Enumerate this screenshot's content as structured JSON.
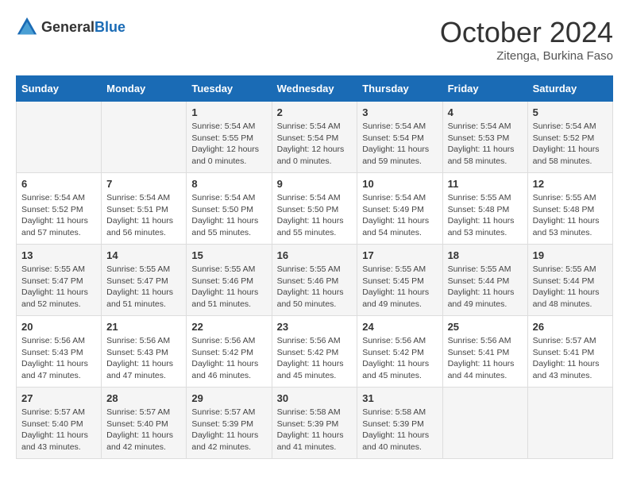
{
  "logo": {
    "text_general": "General",
    "text_blue": "Blue"
  },
  "title": "October 2024",
  "location": "Zitenga, Burkina Faso",
  "days_of_week": [
    "Sunday",
    "Monday",
    "Tuesday",
    "Wednesday",
    "Thursday",
    "Friday",
    "Saturday"
  ],
  "weeks": [
    [
      {
        "day": "",
        "info": ""
      },
      {
        "day": "",
        "info": ""
      },
      {
        "day": "1",
        "info": "Sunrise: 5:54 AM\nSunset: 5:55 PM\nDaylight: 12 hours\nand 0 minutes."
      },
      {
        "day": "2",
        "info": "Sunrise: 5:54 AM\nSunset: 5:54 PM\nDaylight: 12 hours\nand 0 minutes."
      },
      {
        "day": "3",
        "info": "Sunrise: 5:54 AM\nSunset: 5:54 PM\nDaylight: 11 hours\nand 59 minutes."
      },
      {
        "day": "4",
        "info": "Sunrise: 5:54 AM\nSunset: 5:53 PM\nDaylight: 11 hours\nand 58 minutes."
      },
      {
        "day": "5",
        "info": "Sunrise: 5:54 AM\nSunset: 5:52 PM\nDaylight: 11 hours\nand 58 minutes."
      }
    ],
    [
      {
        "day": "6",
        "info": "Sunrise: 5:54 AM\nSunset: 5:52 PM\nDaylight: 11 hours\nand 57 minutes."
      },
      {
        "day": "7",
        "info": "Sunrise: 5:54 AM\nSunset: 5:51 PM\nDaylight: 11 hours\nand 56 minutes."
      },
      {
        "day": "8",
        "info": "Sunrise: 5:54 AM\nSunset: 5:50 PM\nDaylight: 11 hours\nand 55 minutes."
      },
      {
        "day": "9",
        "info": "Sunrise: 5:54 AM\nSunset: 5:50 PM\nDaylight: 11 hours\nand 55 minutes."
      },
      {
        "day": "10",
        "info": "Sunrise: 5:54 AM\nSunset: 5:49 PM\nDaylight: 11 hours\nand 54 minutes."
      },
      {
        "day": "11",
        "info": "Sunrise: 5:55 AM\nSunset: 5:48 PM\nDaylight: 11 hours\nand 53 minutes."
      },
      {
        "day": "12",
        "info": "Sunrise: 5:55 AM\nSunset: 5:48 PM\nDaylight: 11 hours\nand 53 minutes."
      }
    ],
    [
      {
        "day": "13",
        "info": "Sunrise: 5:55 AM\nSunset: 5:47 PM\nDaylight: 11 hours\nand 52 minutes."
      },
      {
        "day": "14",
        "info": "Sunrise: 5:55 AM\nSunset: 5:47 PM\nDaylight: 11 hours\nand 51 minutes."
      },
      {
        "day": "15",
        "info": "Sunrise: 5:55 AM\nSunset: 5:46 PM\nDaylight: 11 hours\nand 51 minutes."
      },
      {
        "day": "16",
        "info": "Sunrise: 5:55 AM\nSunset: 5:46 PM\nDaylight: 11 hours\nand 50 minutes."
      },
      {
        "day": "17",
        "info": "Sunrise: 5:55 AM\nSunset: 5:45 PM\nDaylight: 11 hours\nand 49 minutes."
      },
      {
        "day": "18",
        "info": "Sunrise: 5:55 AM\nSunset: 5:44 PM\nDaylight: 11 hours\nand 49 minutes."
      },
      {
        "day": "19",
        "info": "Sunrise: 5:55 AM\nSunset: 5:44 PM\nDaylight: 11 hours\nand 48 minutes."
      }
    ],
    [
      {
        "day": "20",
        "info": "Sunrise: 5:56 AM\nSunset: 5:43 PM\nDaylight: 11 hours\nand 47 minutes."
      },
      {
        "day": "21",
        "info": "Sunrise: 5:56 AM\nSunset: 5:43 PM\nDaylight: 11 hours\nand 47 minutes."
      },
      {
        "day": "22",
        "info": "Sunrise: 5:56 AM\nSunset: 5:42 PM\nDaylight: 11 hours\nand 46 minutes."
      },
      {
        "day": "23",
        "info": "Sunrise: 5:56 AM\nSunset: 5:42 PM\nDaylight: 11 hours\nand 45 minutes."
      },
      {
        "day": "24",
        "info": "Sunrise: 5:56 AM\nSunset: 5:42 PM\nDaylight: 11 hours\nand 45 minutes."
      },
      {
        "day": "25",
        "info": "Sunrise: 5:56 AM\nSunset: 5:41 PM\nDaylight: 11 hours\nand 44 minutes."
      },
      {
        "day": "26",
        "info": "Sunrise: 5:57 AM\nSunset: 5:41 PM\nDaylight: 11 hours\nand 43 minutes."
      }
    ],
    [
      {
        "day": "27",
        "info": "Sunrise: 5:57 AM\nSunset: 5:40 PM\nDaylight: 11 hours\nand 43 minutes."
      },
      {
        "day": "28",
        "info": "Sunrise: 5:57 AM\nSunset: 5:40 PM\nDaylight: 11 hours\nand 42 minutes."
      },
      {
        "day": "29",
        "info": "Sunrise: 5:57 AM\nSunset: 5:39 PM\nDaylight: 11 hours\nand 42 minutes."
      },
      {
        "day": "30",
        "info": "Sunrise: 5:58 AM\nSunset: 5:39 PM\nDaylight: 11 hours\nand 41 minutes."
      },
      {
        "day": "31",
        "info": "Sunrise: 5:58 AM\nSunset: 5:39 PM\nDaylight: 11 hours\nand 40 minutes."
      },
      {
        "day": "",
        "info": ""
      },
      {
        "day": "",
        "info": ""
      }
    ]
  ]
}
